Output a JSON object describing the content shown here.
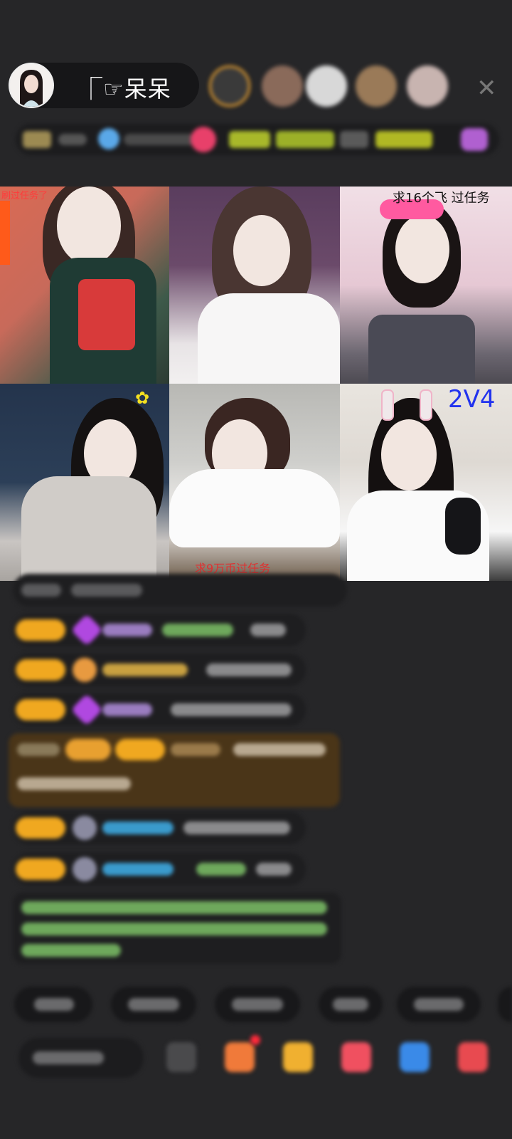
{
  "header": {
    "host_name": "⎾☞呆呆",
    "close_icon": "close-icon"
  },
  "grid": {
    "cells": [
      {
        "overlay": "刷过任务了",
        "color": "#ff3b3b"
      },
      {
        "overlay": ""
      },
      {
        "overlay": "求16个飞 过任务",
        "color": "#111111"
      },
      {
        "overlay": ""
      },
      {
        "overlay": "求9万币过任务",
        "color": "#e03030"
      },
      {
        "overlay": "2V4",
        "color": "#2233ee"
      }
    ]
  },
  "colors": {
    "background": "#262628",
    "badge": "#f0a820",
    "accent_red": "#ff3b3b",
    "green_text": "#8cd37a"
  }
}
